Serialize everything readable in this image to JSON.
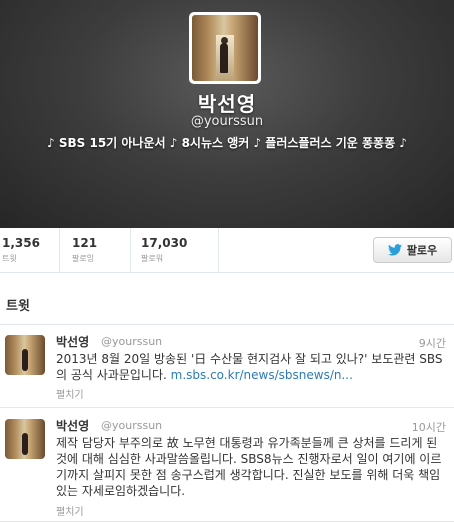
{
  "profile": {
    "display_name": "박선영",
    "screen_name": "@yourssun",
    "bio": "♪ SBS 15기 아나운서 ♪ 8시뉴스 앵커 ♪ 플러스플러스 기운 퐁퐁퐁 ♪"
  },
  "stats": [
    {
      "value": "1,356",
      "label": "트윗"
    },
    {
      "value": "121",
      "label": "팔로잉"
    },
    {
      "value": "17,030",
      "label": "팔로워"
    }
  ],
  "follow_button": {
    "label": "팔로우",
    "icon": "twitter-bird-icon"
  },
  "section": {
    "title": "트윗"
  },
  "tweets": [
    {
      "name": "박선영",
      "handle": "@yourssun",
      "time": "9시간",
      "text": "2013년 8월 20일 방송된 '日 수산물 현지검사 잘 되고 있나?' 보도관련 SBS의 공식 사과문입니다.",
      "link": "m.sbs.co.kr/news/sbsnews/n...",
      "expand": "펼치기"
    },
    {
      "name": "박선영",
      "handle": "@yourssun",
      "time": "10시간",
      "text": "제작 담당자 부주의로 故 노무현 대통령과 유가족분들께 큰 상처를 드리게 된 것에 대해 심심한 사과말씀올립니다. SBS8뉴스 진행자로서 일이 여기에 이르기까지 살피지 못한 점 송구스럽게 생각합니다. 진실한 보도를 위해 더욱 책임있는 자세로임하겠습니다.",
      "expand": "펼치기"
    }
  ],
  "colors": {
    "link": "#2b7bb9",
    "header_bg": "#3d3d3d"
  }
}
